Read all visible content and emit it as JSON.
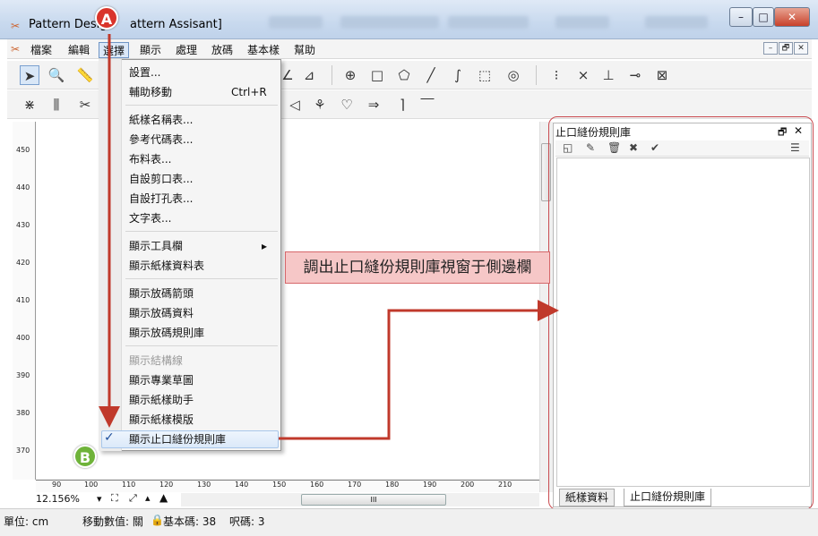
{
  "window": {
    "title_prefix": "Pattern Desig",
    "title_suffix": "attern Assisant]",
    "controls": {
      "minimize": "–",
      "maximize": "□",
      "close": "✕"
    }
  },
  "menubar": {
    "items": [
      "檔案",
      "編輯",
      "選擇",
      "顯示",
      "處理",
      "放碼",
      "基本樣",
      "幫助"
    ],
    "active_index": 2,
    "mdi_buttons": [
      "–",
      "🗗",
      "✕"
    ]
  },
  "dropdown": {
    "items": [
      {
        "label": "設置..."
      },
      {
        "label": "輔助移動",
        "shortcut": "Ctrl+R"
      },
      {
        "label": "紙樣名稱表..."
      },
      {
        "label": "參考代碼表..."
      },
      {
        "label": "布料表..."
      },
      {
        "label": "自設剪口表..."
      },
      {
        "label": "自設打孔表..."
      },
      {
        "label": "文字表..."
      },
      {
        "label": "顯示工具欄",
        "submenu": "▸"
      },
      {
        "label": "顯示紙樣資料表"
      },
      {
        "label": "顯示放碼箭頭"
      },
      {
        "label": "顯示放碼資料"
      },
      {
        "label": "顯示放碼規則庫"
      },
      {
        "label": "顯示結構線",
        "disabled": true
      },
      {
        "label": "顯示專業草圖"
      },
      {
        "label": "顯示紙樣助手"
      },
      {
        "label": "顯示紙樣模版"
      },
      {
        "label": "顯示止口縫份規則庫",
        "checked": true
      }
    ],
    "check_mark": "✓"
  },
  "canvas": {
    "v_ruler": [
      "450",
      "440",
      "430",
      "420",
      "410",
      "400",
      "390",
      "380",
      "370"
    ],
    "h_ruler": [
      "90",
      "100",
      "110",
      "120",
      "130",
      "140",
      "150",
      "160",
      "170",
      "180",
      "190",
      "200",
      "210"
    ],
    "zoom": "12.156%",
    "zoom_arrow": "▾",
    "scroll_grip": "III"
  },
  "side_panel": {
    "title": "止口縫份規則庫",
    "title_buttons": [
      "🗗",
      "✕"
    ],
    "tabs": [
      "紙樣資料",
      "止口縫份規則庫"
    ],
    "active_tab": 1
  },
  "annotations": {
    "callout": "調出止口縫份規則庫視窗于側邊欄",
    "badge_a": "A",
    "badge_b": "B",
    "colors": {
      "badge_a": "#d9342b",
      "badge_b": "#6fb33a",
      "arrow": "#c0392b"
    }
  },
  "statusbar": {
    "unit": "單位: cm",
    "move": "移動數值: 關",
    "base": "基本碼: 38",
    "code": "呎碼: 3"
  },
  "icons": {
    "toolbar1": [
      "select-arrow-icon",
      "zoom-icon",
      "ruler-icon",
      "angle-icon",
      "rotate-icon",
      "circle-cross-icon",
      "rectangle-icon",
      "pentagon-icon",
      "line-icon",
      "curve-icon",
      "dashed-rect-icon",
      "spiral-icon",
      "dot-icon",
      "cross-icon",
      "axis-icon",
      "measure-icon",
      "node-box-icon"
    ],
    "toolbar2": [
      "slash-icon",
      "bars-icon",
      "scissors-icon",
      "arrow-left-icon",
      "flower-icon",
      "heart-icon",
      "pin-icon",
      "corner-icon",
      "corner2-icon"
    ]
  }
}
